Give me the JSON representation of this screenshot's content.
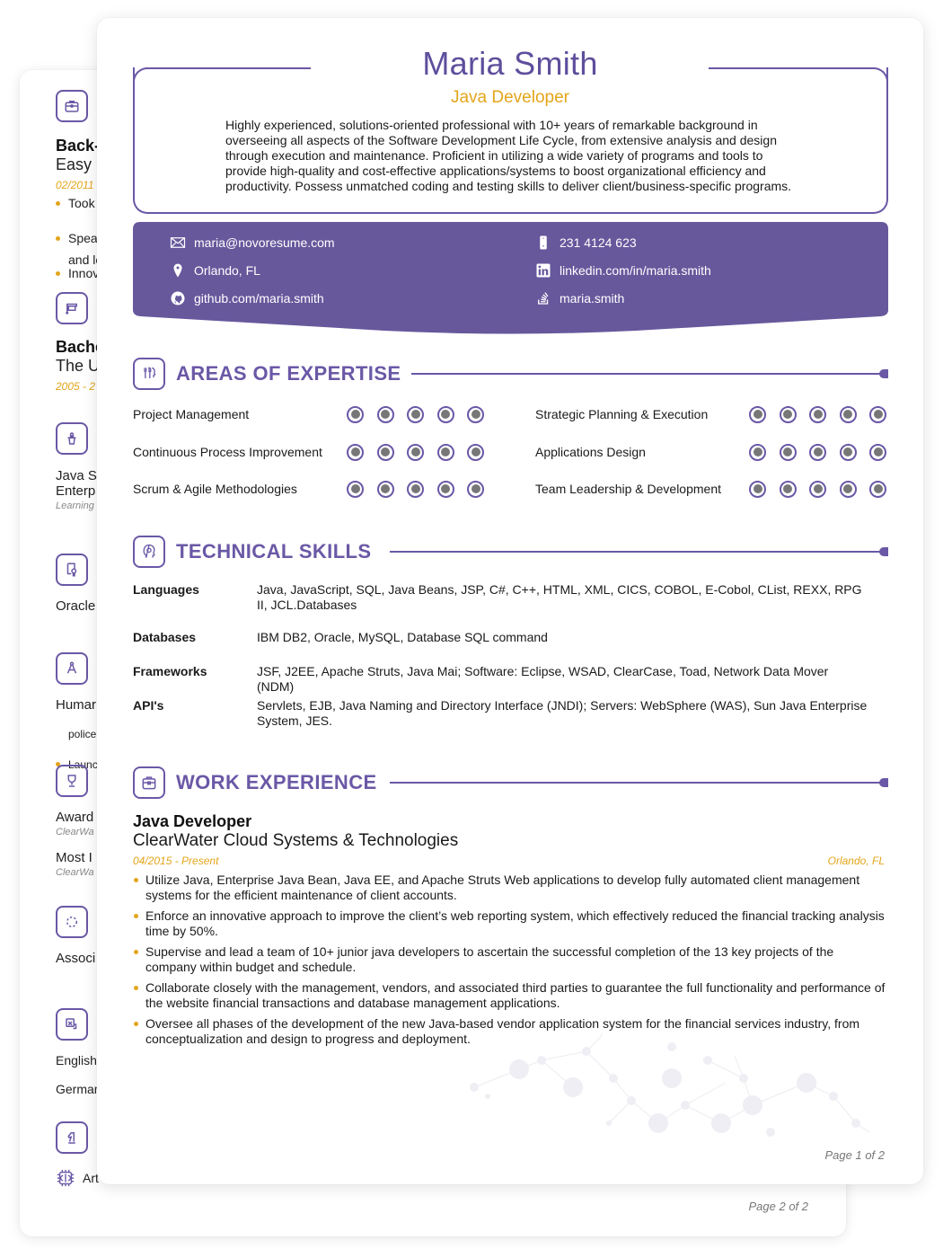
{
  "back_page": {
    "experience": {
      "icon": "briefcase-icon",
      "title": "Back-",
      "company": "Easy S",
      "date": "02/2011",
      "bullets": [
        "Took",
        "Spear",
        "Innov",
        "and lo"
      ]
    },
    "education": {
      "icon": "graduation-cap-icon",
      "degree": "Bache",
      "school": "The U",
      "date": "2005 - 2"
    },
    "conferences": {
      "icon": "podium-icon",
      "line1": "Java S",
      "line2": "Enterp",
      "sub": "Learning"
    },
    "certificates": {
      "icon": "certificate-icon",
      "item": "Oracle"
    },
    "volunteering": {
      "icon": "compass-icon",
      "item": "Humar",
      "bullets": [
        "Launc",
        "police"
      ]
    },
    "awards": {
      "icon": "trophy-icon",
      "items": [
        {
          "title": "Award",
          "sub": "ClearWa"
        },
        {
          "title": "Most I",
          "sub": "ClearWa"
        }
      ]
    },
    "organizations": {
      "icon": "network-icon",
      "item": "Associ"
    },
    "languages": {
      "icon": "translate-icon",
      "items": [
        "English",
        "German"
      ]
    },
    "interests": {
      "icon": "chess-knight-icon",
      "items": [
        {
          "icon": "brain-chip-icon",
          "label": "Art"
        }
      ]
    },
    "footer": "Page 2 of 2"
  },
  "front_page": {
    "header": {
      "name": "Maria Smith",
      "role": "Java Developer",
      "summary": "Highly experienced, solutions-oriented professional with 10+ years of remarkable background in overseeing all aspects of the Software Development Life Cycle, from extensive analysis and design through execution and maintenance. Proficient in utilizing a wide variety of programs and tools to provide high-quality and cost-effective applications/systems to boost organizational efficiency and productivity. Possess unmatched coding and testing skills to deliver client/business-specific programs."
    },
    "contact": {
      "email": {
        "icon": "envelope-icon",
        "value": "maria@novoresume.com"
      },
      "phone": {
        "icon": "phone-icon",
        "value": "231 4124 623"
      },
      "location": {
        "icon": "map-pin-icon",
        "value": "Orlando, FL"
      },
      "linkedin": {
        "icon": "linkedin-icon",
        "value": "linkedin.com/in/maria.smith"
      },
      "github": {
        "icon": "github-icon",
        "value": "github.com/maria.smith"
      },
      "stackoverflow": {
        "icon": "stackoverflow-icon",
        "value": "maria.smith"
      }
    },
    "expertise": {
      "title": "AREAS OF EXPERTISE",
      "icon": "brain-tools-icon",
      "max_rating": 5,
      "items": [
        {
          "label": "Project Management",
          "rating": 5
        },
        {
          "label": "Strategic Planning & Execution",
          "rating": 5
        },
        {
          "label": "Continuous Process Improvement",
          "rating": 5
        },
        {
          "label": "Applications Design",
          "rating": 5
        },
        {
          "label": "Scrum & Agile Methodologies",
          "rating": 5
        },
        {
          "label": "Team Leadership & Development",
          "rating": 5
        }
      ]
    },
    "technical_skills": {
      "title": "TECHNICAL SKILLS",
      "icon": "head-gear-icon",
      "rows": [
        {
          "label": "Languages",
          "value": "Java, JavaScript, SQL, Java Beans, JSP, C#, C++, HTML, XML, CICS, COBOL, E-Cobol, CList, REXX, RPG II, JCL.Databases"
        },
        {
          "label": "Databases",
          "value": "IBM DB2, Oracle, MySQL, Database SQL command"
        },
        {
          "label": "Frameworks",
          "value": "JSF, J2EE, Apache Struts, Java Mai; Software: Eclipse, WSAD, ClearCase, Toad, Network Data Mover (NDM)"
        },
        {
          "label": "API's",
          "value": "Servlets, EJB, Java Naming and Directory Interface (JNDI); Servers: WebSphere (WAS), Sun Java Enterprise System, JES."
        }
      ]
    },
    "work_experience": {
      "title": "WORK EXPERIENCE",
      "icon": "briefcase-icon",
      "jobs": [
        {
          "title": "Java Developer",
          "company": "ClearWater Cloud Systems & Technologies",
          "date": "04/2015 - Present",
          "location": "Orlando, FL",
          "bullets": [
            "Utilize Java, Enterprise Java Bean, Java EE, and Apache Struts Web applications to develop fully automated client management systems for the efficient maintenance of client accounts.",
            "Enforce an innovative approach to improve the client’s web reporting system, which effectively reduced the financial tracking analysis time by 50%.",
            "Supervise and lead a team of 10+ junior java developers to ascertain the successful completion of the 13 key projects of the company within budget and schedule.",
            "Collaborate closely with the management, vendors, and associated third parties to guarantee the full functionality and performance of the website financial transactions and database management applications.",
            "Oversee all phases of the development of the new Java-based vendor application system for the financial services industry, from conceptualization and design to progress and deployment."
          ]
        }
      ]
    },
    "footer": "Page 1 of 2"
  },
  "colors": {
    "accent": "#6a58a6",
    "name": "#5e4e9c",
    "highlight": "#e3a51a",
    "rating_fill": "#777777"
  }
}
